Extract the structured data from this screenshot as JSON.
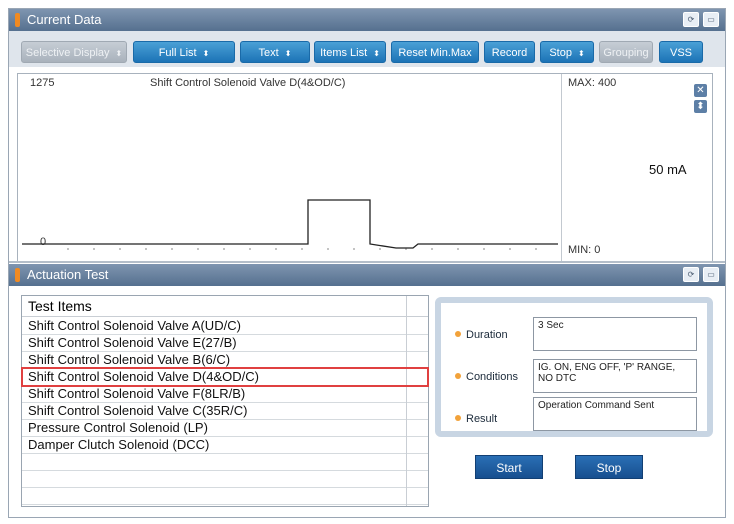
{
  "current_panel": {
    "title": "Current Data",
    "icons": [
      "retry-icon",
      "minimize-icon"
    ]
  },
  "toolbar": {
    "buttons": [
      {
        "label": "Selective Display",
        "dropdown": true,
        "enabled": false
      },
      {
        "label": "Full List",
        "dropdown": true,
        "enabled": true
      },
      {
        "label": "Text",
        "dropdown": true,
        "enabled": true
      },
      {
        "label": "Items List",
        "dropdown": true,
        "enabled": true
      },
      {
        "label": "Reset Min.Max",
        "dropdown": false,
        "enabled": true
      },
      {
        "label": "Record",
        "dropdown": false,
        "enabled": true
      },
      {
        "label": "Stop",
        "dropdown": true,
        "enabled": true
      },
      {
        "label": "Grouping",
        "dropdown": false,
        "enabled": false
      },
      {
        "label": "VSS",
        "dropdown": false,
        "enabled": true
      }
    ]
  },
  "graph": {
    "top_value": "1275",
    "item_name": "Shift Control Solenoid Valve D(4&OD/C)",
    "zero_label": "0",
    "max_label": "MAX: 400",
    "min_label": "MIN: 0",
    "current_value": "50 mA",
    "colors": {
      "trace": "#222222",
      "grid": "#888888"
    }
  },
  "actuation_panel": {
    "title": "Actuation Test",
    "icons": [
      "retry-icon",
      "minimize-icon"
    ]
  },
  "test_list": {
    "header": "Test Items",
    "items": [
      "Shift Control Solenoid Valve A(UD/C)",
      "Shift Control Solenoid Valve E(27/B)",
      "Shift Control Solenoid Valve B(6/C)",
      "Shift Control Solenoid Valve D(4&OD/C)",
      "Shift Control Solenoid Valve F(8LR/B)",
      "Shift Control Solenoid Valve C(35R/C)",
      "Pressure Control Solenoid (LP)",
      "Damper Clutch Solenoid (DCC)",
      "",
      "",
      ""
    ],
    "selected_index": 3,
    "selected_color": "#e04040"
  },
  "info": {
    "duration_label": "Duration",
    "duration_value": "3 Sec",
    "conditions_label": "Conditions",
    "conditions_value": "IG. ON, ENG OFF, 'P' RANGE, NO DTC",
    "result_label": "Result",
    "result_value": "Operation Command Sent"
  },
  "actions": {
    "start_label": "Start",
    "stop_label": "Stop"
  }
}
